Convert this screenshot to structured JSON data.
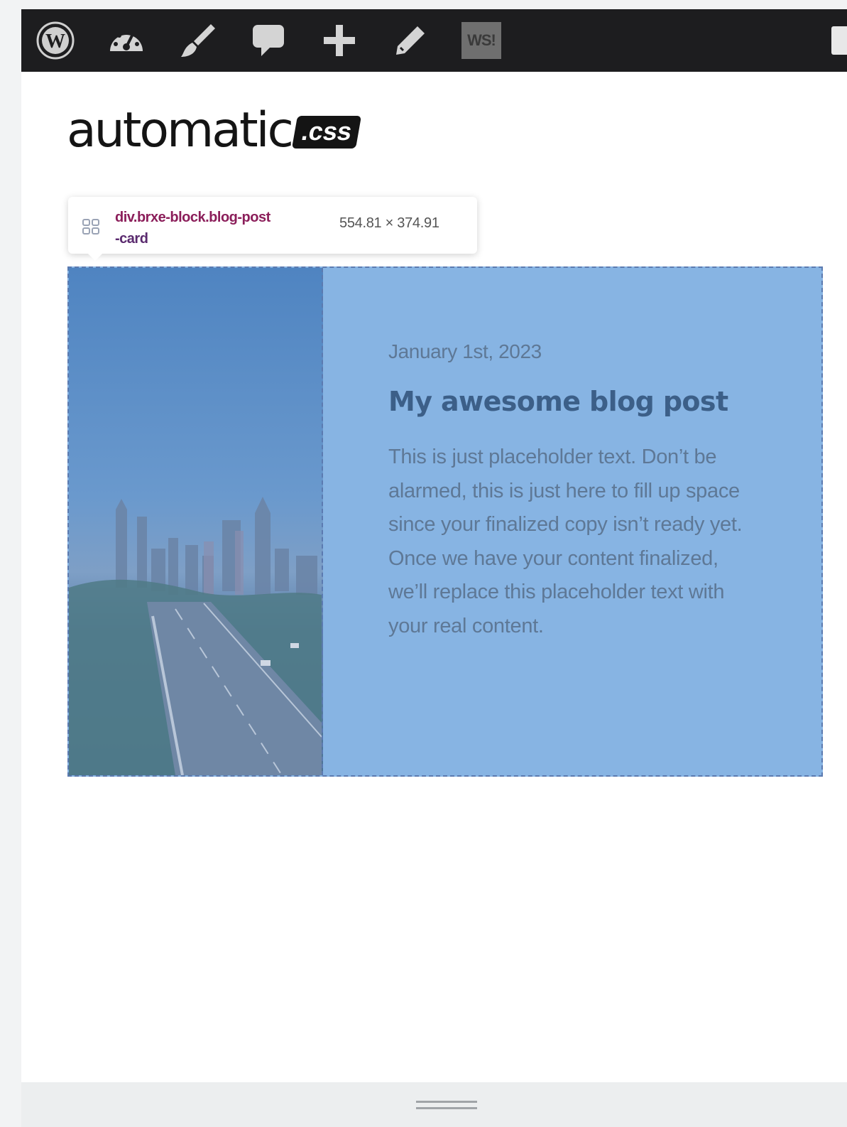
{
  "admin_bar": {
    "items": [
      "wordpress-icon",
      "dashboard-icon",
      "customize-icon",
      "comments-icon",
      "new-content-icon",
      "edit-icon"
    ],
    "ws_badge": "WS!"
  },
  "logo": {
    "word": "automatic",
    "badge": ".css"
  },
  "inspector_tooltip": {
    "selector_line1": "div.brxe-block.blog-post",
    "selector_line2": "-card",
    "dimensions": "554.81 × 374.91"
  },
  "post_card": {
    "date": "January 1st, 2023",
    "title": "My awesome blog post",
    "excerpt": "This is just placeholder text. Don’t be alarmed, this is just here to fill up space since your finalized copy isn’t ready yet. Once we have your content finalized, we’ll replace this placeholder text with your real content."
  },
  "colors": {
    "admin_bar": "#1d1d1f",
    "highlight_overlay": "#87b4e3",
    "title_text": "#3c5f88"
  }
}
